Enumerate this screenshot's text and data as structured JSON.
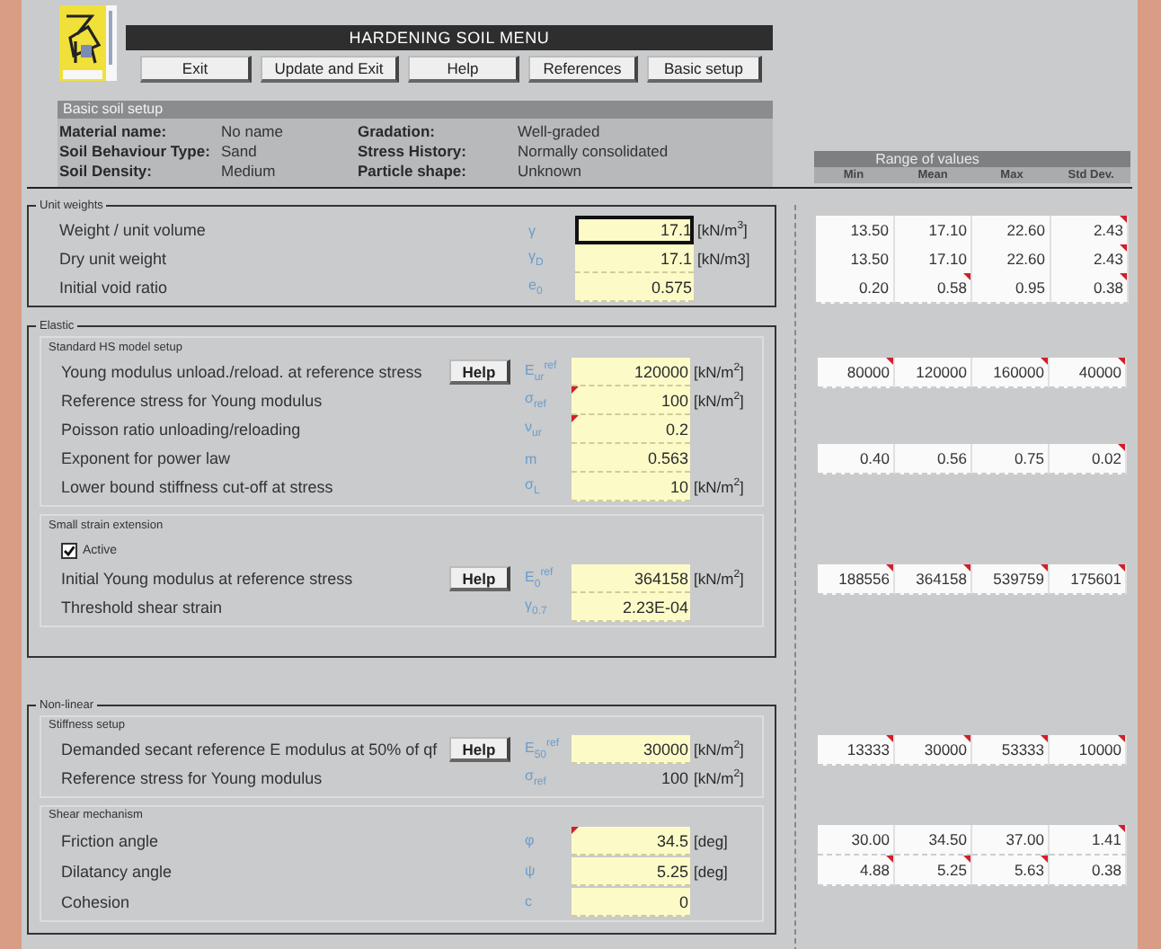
{
  "title": "HARDENING SOIL MENU",
  "buttons": [
    "Exit",
    "Update and Exit",
    "Help",
    "References",
    "Basic setup"
  ],
  "basic_setup": {
    "title": "Basic soil setup",
    "fields": [
      {
        "label": "Material name:",
        "value": "No name"
      },
      {
        "label": "Gradation:",
        "value": "Well-graded"
      },
      {
        "label": "Soil Behaviour Type:",
        "value": "Sand"
      },
      {
        "label": "Stress History:",
        "value": "Normally consolidated"
      },
      {
        "label": "Soil Density:",
        "value": "Medium"
      },
      {
        "label": "Particle shape:",
        "value": "Unknown"
      }
    ]
  },
  "range_header": {
    "title": "Range of values",
    "columns": [
      "Min",
      "Mean",
      "Max",
      "Std Dev."
    ]
  },
  "sections": [
    {
      "title": "Unit weights",
      "rows": [
        {
          "kind": "parameter",
          "label": "Weight / unit volume",
          "symbol": "γ",
          "value": "17.1",
          "unit": "[kN/m$^{3}$]",
          "editable": true,
          "selected": true,
          "comment": false,
          "range": [
            {
              "text": "13.50",
              "comment": false
            },
            {
              "text": "17.10",
              "comment": false
            },
            {
              "text": "22.60",
              "comment": false
            },
            {
              "text": "2.43",
              "comment": true
            }
          ]
        },
        {
          "kind": "parameter",
          "label": "Dry unit weight",
          "symbol": "γ$_{D}$",
          "value": "17.1",
          "unit": "[kN/m3]",
          "editable": true,
          "selected": false,
          "comment": false,
          "range": [
            {
              "text": "13.50",
              "comment": false
            },
            {
              "text": "17.10",
              "comment": false
            },
            {
              "text": "22.60",
              "comment": false
            },
            {
              "text": "2.43",
              "comment": true
            }
          ]
        },
        {
          "kind": "parameter",
          "label": "Initial void ratio",
          "symbol": "e$_{0}$",
          "value": "0.575",
          "editable": true,
          "selected": false,
          "comment": false,
          "range": [
            {
              "text": "0.20",
              "comment": false
            },
            {
              "text": "0.58",
              "comment": true
            },
            {
              "text": "0.95",
              "comment": false
            },
            {
              "text": "0.38",
              "comment": true
            }
          ]
        }
      ]
    },
    {
      "title": "Elastic",
      "groups": [
        {
          "title": "Standard HS model setup",
          "rows": [
            {
              "kind": "parameter",
              "label": "Young modulus unload./reload. at reference stress",
              "help": "Help",
              "symbol": "E$_{ur}$$^{ref}$",
              "value": "120000",
              "unit": "[kN/m$^{2}$]",
              "editable": true,
              "selected": false,
              "comment": false,
              "range": [
                {
                  "text": "80000",
                  "comment": true
                },
                {
                  "text": "120000",
                  "comment": false
                },
                {
                  "text": "160000",
                  "comment": true
                },
                {
                  "text": "40000",
                  "comment": true
                }
              ]
            },
            {
              "kind": "parameter",
              "label": "Reference stress for Young modulus",
              "symbol": "σ$_{ref}$",
              "value": "100",
              "unit": "[kN/m$^{2}$]",
              "editable": true,
              "selected": false,
              "comment": true
            },
            {
              "kind": "parameter",
              "label": "Poisson ratio unloading/reloading",
              "symbol": "ν$_{ur}$",
              "value": "0.2",
              "editable": true,
              "selected": false,
              "comment": true
            },
            {
              "kind": "parameter",
              "label": "Exponent for power law",
              "symbol": "m",
              "value": "0.563",
              "editable": true,
              "selected": false,
              "comment": false,
              "range": [
                {
                  "text": "0.40",
                  "comment": false
                },
                {
                  "text": "0.56",
                  "comment": false
                },
                {
                  "text": "0.75",
                  "comment": false
                },
                {
                  "text": "0.02",
                  "comment": true
                }
              ]
            },
            {
              "kind": "parameter",
              "label": "Lower bound stiffness cut-off at stress",
              "symbol": "σ$_{L}$",
              "value": "10",
              "unit": "[kN/m$^{2}$]",
              "editable": true,
              "selected": false,
              "comment": false
            }
          ]
        },
        {
          "title": "Small strain extension",
          "rows": [
            {
              "kind": "checkbox",
              "label": "Active",
              "checked": true
            },
            {
              "kind": "parameter",
              "label": "Initial Young modulus at reference stress",
              "help": "Help",
              "symbol": "E$_{0}$$^{ref}$",
              "value": "364158",
              "unit": "[kN/m$^{2}$]",
              "editable": true,
              "selected": false,
              "comment": false,
              "range": [
                {
                  "text": "188556",
                  "comment": true
                },
                {
                  "text": "364158",
                  "comment": true
                },
                {
                  "text": "539759",
                  "comment": true
                },
                {
                  "text": "175601",
                  "comment": true
                }
              ]
            },
            {
              "kind": "parameter",
              "label": "Threshold shear strain",
              "symbol": "γ$_{0.7}$",
              "value": "2.23E-04",
              "editable": true,
              "selected": false,
              "comment": false
            }
          ]
        }
      ]
    },
    {
      "title": "Non-linear",
      "groups": [
        {
          "title": "Stiffness setup",
          "rows": [
            {
              "kind": "parameter",
              "label": "Demanded secant reference E modulus at 50% of qf",
              "help": "Help",
              "symbol": "E$_{50}$$^{ref}$",
              "value": "30000",
              "unit": "[kN/m$^{2}$]",
              "editable": true,
              "selected": false,
              "comment": false,
              "range": [
                {
                  "text": "13333",
                  "comment": true
                },
                {
                  "text": "30000",
                  "comment": true
                },
                {
                  "text": "53333",
                  "comment": true
                },
                {
                  "text": "10000",
                  "comment": true
                }
              ]
            },
            {
              "kind": "parameter",
              "label": "Reference stress for Young modulus",
              "symbol": "σ$_{ref}$",
              "value": "100",
              "unit": "[kN/m$^{2}$]",
              "editable": false,
              "selected": false,
              "comment": false
            }
          ]
        },
        {
          "title": "Shear mechanism",
          "rows": [
            {
              "kind": "parameter",
              "label": "Friction angle",
              "symbol": "φ",
              "value": "34.5",
              "unit": "[deg]",
              "editable": true,
              "selected": false,
              "comment": true,
              "range": [
                {
                  "text": "30.00",
                  "comment": false
                },
                {
                  "text": "34.50",
                  "comment": false
                },
                {
                  "text": "37.00",
                  "comment": false
                },
                {
                  "text": "1.41",
                  "comment": true
                }
              ]
            },
            {
              "kind": "parameter",
              "label": "Dilatancy angle",
              "symbol": "ψ",
              "value": "5.25",
              "unit": "[deg]",
              "editable": true,
              "selected": false,
              "comment": false,
              "range": [
                {
                  "text": "4.88",
                  "comment": true
                },
                {
                  "text": "5.25",
                  "comment": true
                },
                {
                  "text": "5.63",
                  "comment": true
                },
                {
                  "text": "0.38",
                  "comment": false
                }
              ]
            },
            {
              "kind": "parameter",
              "label": "Cohesion",
              "symbol": "c",
              "value": "0",
              "editable": true,
              "selected": false,
              "comment": false
            }
          ]
        }
      ]
    }
  ]
}
